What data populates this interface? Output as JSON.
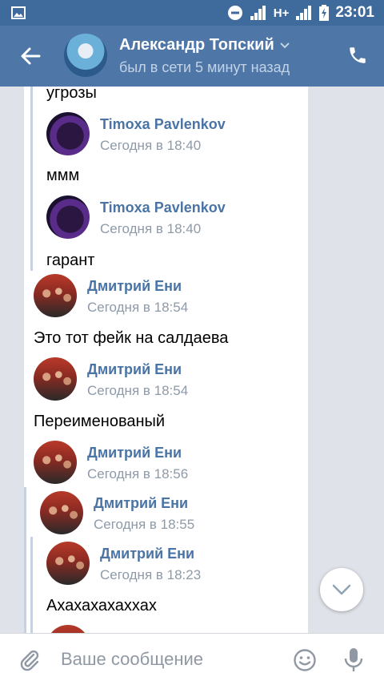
{
  "statusbar": {
    "time": "23:01",
    "network": "H+"
  },
  "header": {
    "contact_name": "Александр Топский",
    "contact_status": "был в сети 5 минут назад"
  },
  "messages": [
    {
      "text": "угрозы"
    },
    {
      "sender": "Timoxa Pavlenkov",
      "time": "Сегодня в 18:40",
      "text": "ммм"
    },
    {
      "sender": "Timoxa Pavlenkov",
      "time": "Сегодня в 18:40",
      "text": "гарант"
    },
    {
      "sender": "Дмитрий Ени",
      "time": "Сегодня в 18:54",
      "text": "Это тот фейк на салдаева"
    },
    {
      "sender": "Дмитрий Ени",
      "time": "Сегодня в 18:54",
      "text": "Переименованый"
    },
    {
      "sender": "Дмитрий Ени",
      "time": "Сегодня в 18:56"
    },
    {
      "sender": "Дмитрий Ени",
      "time": "Сегодня в 18:55"
    },
    {
      "sender": "Дмитрий Ени",
      "time": "Сегодня в 18:23",
      "text": "Ахахахахаххах"
    }
  ],
  "input": {
    "placeholder": "Ваше сообщение"
  },
  "colors": {
    "header": "#4e76a6",
    "statusbar": "#3f6b9c",
    "accent_name": "#4a74a5"
  }
}
